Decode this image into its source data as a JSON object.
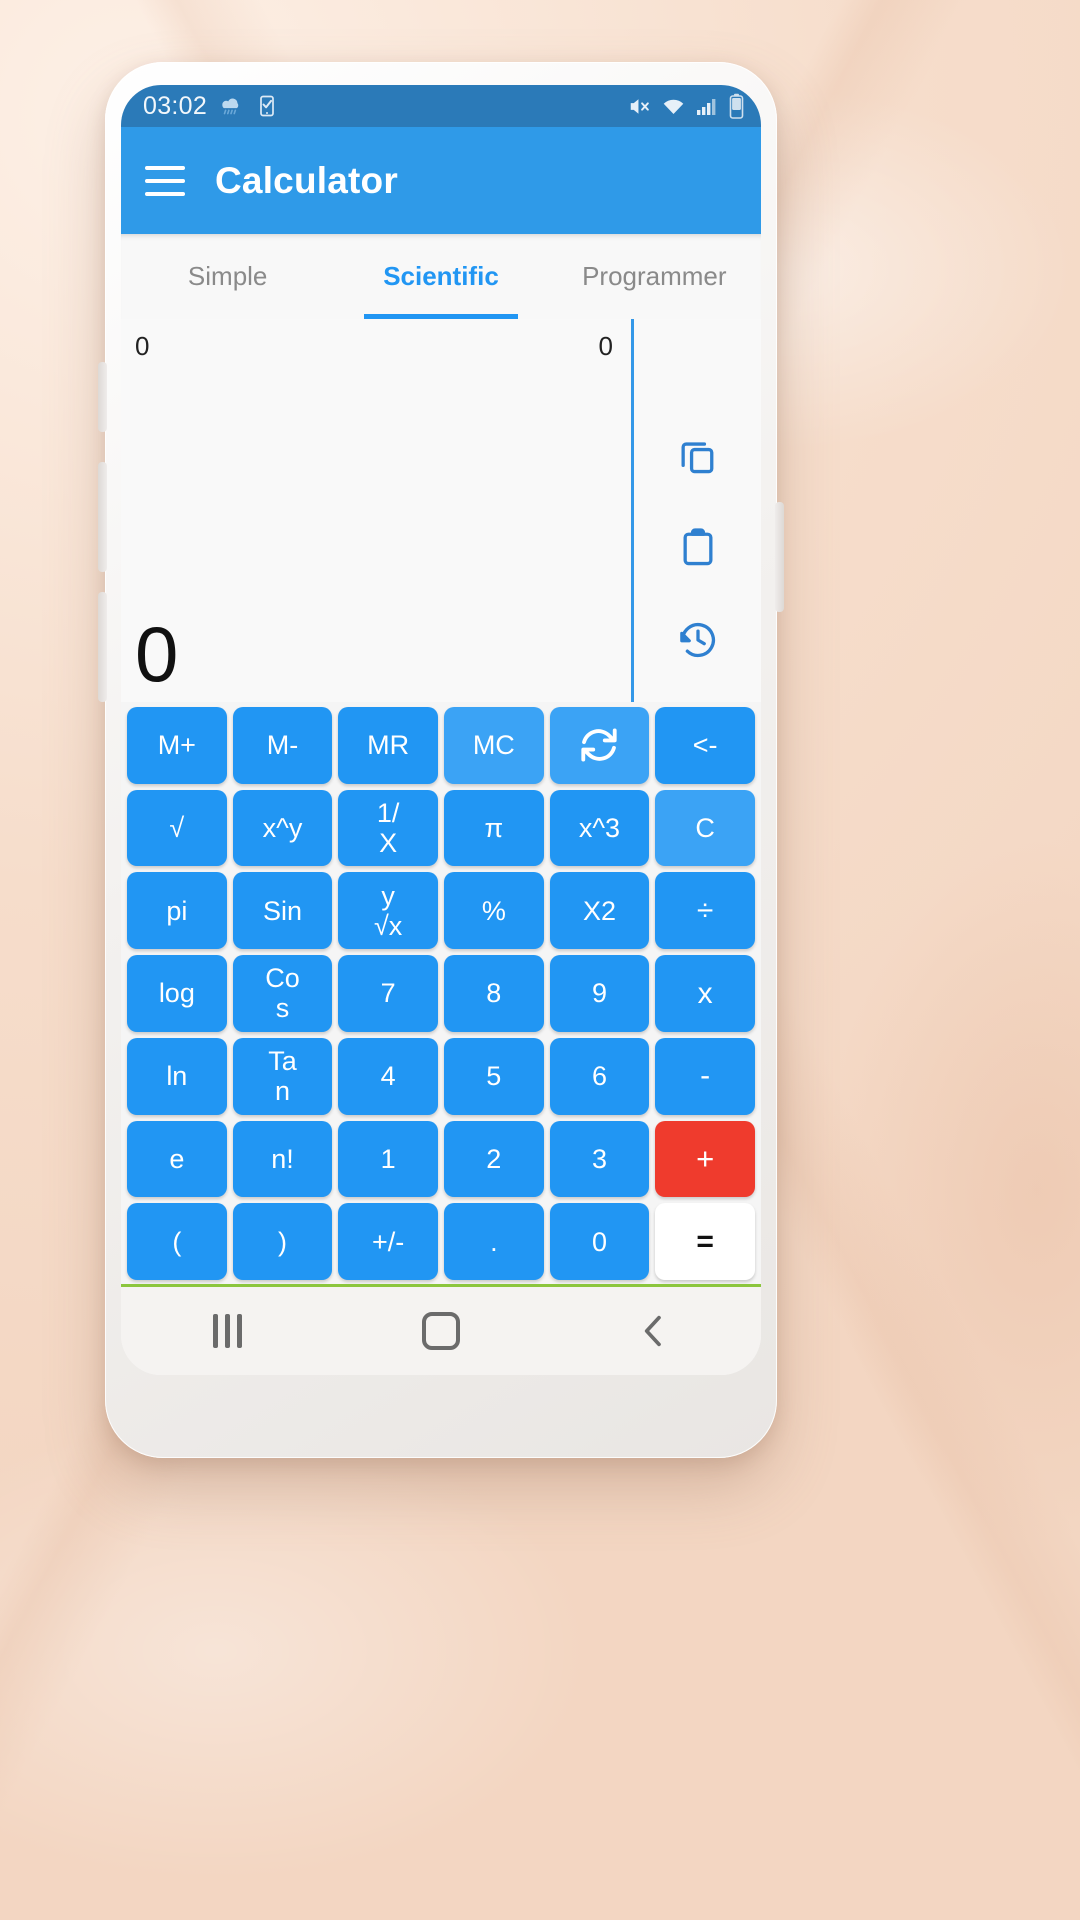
{
  "status_bar": {
    "clock": "03:02",
    "left_icons": [
      "weather-rain-icon",
      "task-check-icon"
    ],
    "right_icons": [
      "mute-icon",
      "wifi-icon",
      "signal-bars-icon",
      "battery-icon"
    ]
  },
  "app_bar": {
    "menu_icon": "hamburger-menu-icon",
    "title": "Calculator"
  },
  "tabs": [
    {
      "label": "Simple",
      "active": false
    },
    {
      "label": "Scientific",
      "active": true
    },
    {
      "label": "Programmer",
      "active": false
    }
  ],
  "display": {
    "expression_left": "0",
    "expression_right": "0",
    "result": "0",
    "tools": [
      {
        "name": "copy-icon",
        "label": "Copy"
      },
      {
        "name": "paste-icon",
        "label": "Paste"
      },
      {
        "name": "history-icon",
        "label": "History"
      }
    ]
  },
  "keypad": {
    "rows": [
      [
        {
          "label": "M+",
          "style": ""
        },
        {
          "label": "M-",
          "style": ""
        },
        {
          "label": "MR",
          "style": ""
        },
        {
          "label": "MC",
          "style": "light"
        },
        {
          "label": "",
          "style": "light",
          "icon": "refresh-icon"
        },
        {
          "label": "<-",
          "style": ""
        }
      ],
      [
        {
          "label": "√",
          "style": ""
        },
        {
          "label": "x^y",
          "style": ""
        },
        {
          "label": "1/\nX",
          "style": ""
        },
        {
          "label": "π",
          "style": ""
        },
        {
          "label": "x^3",
          "style": ""
        },
        {
          "label": "C",
          "style": "light"
        }
      ],
      [
        {
          "label": "pi",
          "style": ""
        },
        {
          "label": "Sin",
          "style": ""
        },
        {
          "label": "y\n√x",
          "style": ""
        },
        {
          "label": "%",
          "style": ""
        },
        {
          "label": "X2",
          "style": ""
        },
        {
          "label": "÷",
          "style": "op"
        }
      ],
      [
        {
          "label": "log",
          "style": ""
        },
        {
          "label": "Co\ns",
          "style": ""
        },
        {
          "label": "7",
          "style": ""
        },
        {
          "label": "8",
          "style": ""
        },
        {
          "label": "9",
          "style": ""
        },
        {
          "label": "x",
          "style": "op"
        }
      ],
      [
        {
          "label": "ln",
          "style": ""
        },
        {
          "label": "Ta\nn",
          "style": ""
        },
        {
          "label": "4",
          "style": ""
        },
        {
          "label": "5",
          "style": ""
        },
        {
          "label": "6",
          "style": ""
        },
        {
          "label": "-",
          "style": "op"
        }
      ],
      [
        {
          "label": "e",
          "style": ""
        },
        {
          "label": "n!",
          "style": ""
        },
        {
          "label": "1",
          "style": ""
        },
        {
          "label": "2",
          "style": ""
        },
        {
          "label": "3",
          "style": ""
        },
        {
          "label": "+",
          "style": "plus"
        }
      ],
      [
        {
          "label": "(",
          "style": ""
        },
        {
          "label": ")",
          "style": ""
        },
        {
          "label": "+/-",
          "style": ""
        },
        {
          "label": ".",
          "style": ""
        },
        {
          "label": "0",
          "style": ""
        },
        {
          "label": "=",
          "style": "equals"
        }
      ]
    ]
  },
  "nav_bar": {
    "recents_label": "Recents",
    "home_label": "Home",
    "back_label": "Back"
  },
  "colors": {
    "accent": "#2196f3",
    "appbar": "#2f9ae8",
    "statusbar": "#2b7ab8",
    "plus_key": "#ef3b2d",
    "key_light": "#3ba3f5"
  }
}
